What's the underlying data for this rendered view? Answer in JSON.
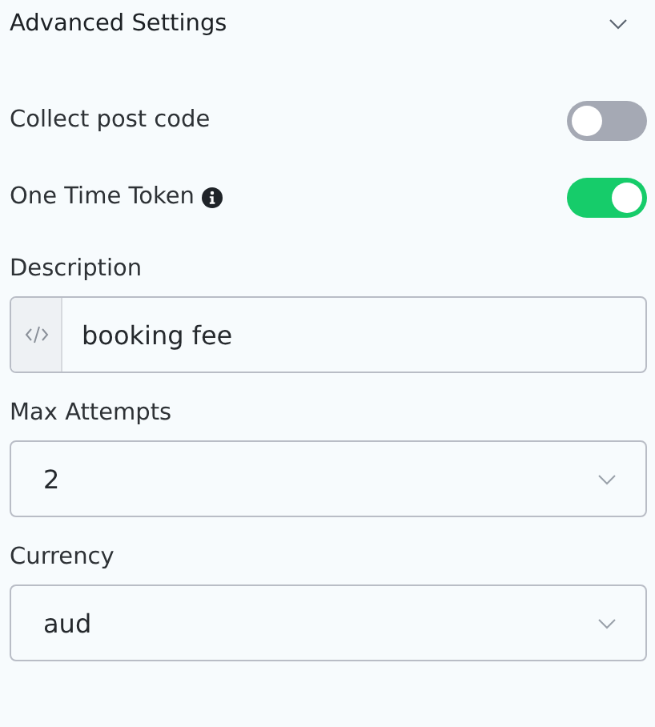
{
  "section": {
    "title": "Advanced Settings",
    "expanded": true
  },
  "toggles": [
    {
      "label": "Collect post code",
      "on": false,
      "info": false
    },
    {
      "label": "One Time Token",
      "on": true,
      "info": true
    }
  ],
  "fields": [
    {
      "kind": "code",
      "label": "Description",
      "value": "booking fee"
    },
    {
      "kind": "select",
      "label": "Max Attempts",
      "value": "2"
    },
    {
      "kind": "select",
      "label": "Currency",
      "value": "aud"
    }
  ]
}
